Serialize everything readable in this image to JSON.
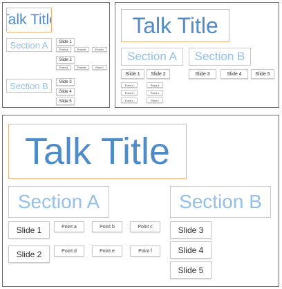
{
  "colors": {
    "title_text": "#4f8ac9",
    "title_border": "#f0b27a",
    "section_text": "#93bfe8",
    "box_border": "#c8c8c8",
    "panel_border": "#6b6b6b"
  },
  "variants": [
    {
      "title": "Talk Title",
      "section_a": "Section A",
      "section_b": "Section B",
      "slides": [
        "Slide 1",
        "Slide 2",
        "Slide 3",
        "Slide 4",
        "Slide 5"
      ],
      "points": [
        "Point a",
        "Point b",
        "Point c",
        "Point d",
        "Point e",
        "Point f"
      ]
    },
    {
      "title": "Talk Title",
      "section_a": "Section A",
      "section_b": "Section B",
      "slides": [
        "Slide 1",
        "Slide 2",
        "Slide 3",
        "Slide 4",
        "Slide 5"
      ],
      "points": [
        "Point a",
        "Point b",
        "Point c",
        "Point d",
        "Point e",
        "Point f"
      ]
    },
    {
      "title": "Talk Title",
      "section_a": "Section A",
      "section_b": "Section B",
      "slides": [
        "Slide 1",
        "Slide 2",
        "Slide 3",
        "Slide 4",
        "Slide 5"
      ],
      "points": [
        "Point a",
        "Point b",
        "Point c",
        "Point d",
        "Point e",
        "Point f"
      ]
    }
  ]
}
